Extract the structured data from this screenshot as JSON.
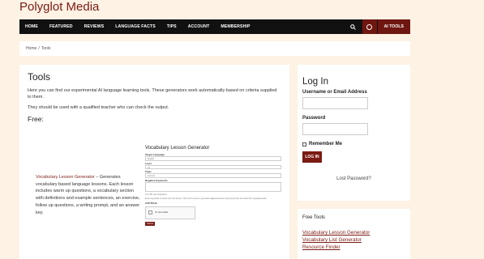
{
  "site": {
    "title": "Polyglot Media"
  },
  "nav": {
    "items": [
      "HOME",
      "FEATURED",
      "REVIEWS",
      "LANGUAGE FACTS",
      "TIPS",
      "ACCOUNT",
      "MEMBERSHIP"
    ],
    "ai_tools": "AI TOOLS"
  },
  "breadcrumb": {
    "home": "Home",
    "sep": "/",
    "current": "Tools"
  },
  "main": {
    "title": "Tools",
    "intro": "Here you can find our experimental AI language learning tools. These generators work automatically based on criteria supplied to them.",
    "note": "They should be used with a qualified teacher who can check the output.",
    "free_heading": "Free:",
    "tool_link": "Vocabulary Lesson Generator",
    "tool_desc": " – Generates vocabulary based language lessons. Each lesson includes warm up questions, a vocabulary section with definitions and example sentences, an exercise, follow up questions, a writing prompt, and an answer key."
  },
  "preview": {
    "title": "Vocabulary Lesson Generator",
    "fields": [
      {
        "label": "Target Language",
        "value": "English"
      },
      {
        "label": "Level",
        "value": "A1"
      },
      {
        "label": "Topic",
        "value": "General"
      }
    ],
    "keywords_label": "Negative Keywords",
    "counter": "0 of 700 max characters",
    "hint": "Enter keywords or words from the lesson. This can be done to generate targeted lessons and prevent the AI model from repeating itself.",
    "captcha_label": "CAPTCHA",
    "captcha_text": "I'm not a robot",
    "submit": "Submit"
  },
  "login": {
    "title": "Log In",
    "username_label": "Username or Email Address",
    "password_label": "Password",
    "remember_label": "Remember Me",
    "button": "LOG IN",
    "lost": "Lost Password?"
  },
  "free_tools": {
    "title": "Free Tools",
    "links": [
      "Vocabulary Lesson Generator",
      "Vocabulary List Generator",
      "Resource Finder"
    ]
  },
  "colors": {
    "brand": "#7a1b14",
    "nav_bg": "#111111",
    "page_bg": "#fdf2e4"
  }
}
